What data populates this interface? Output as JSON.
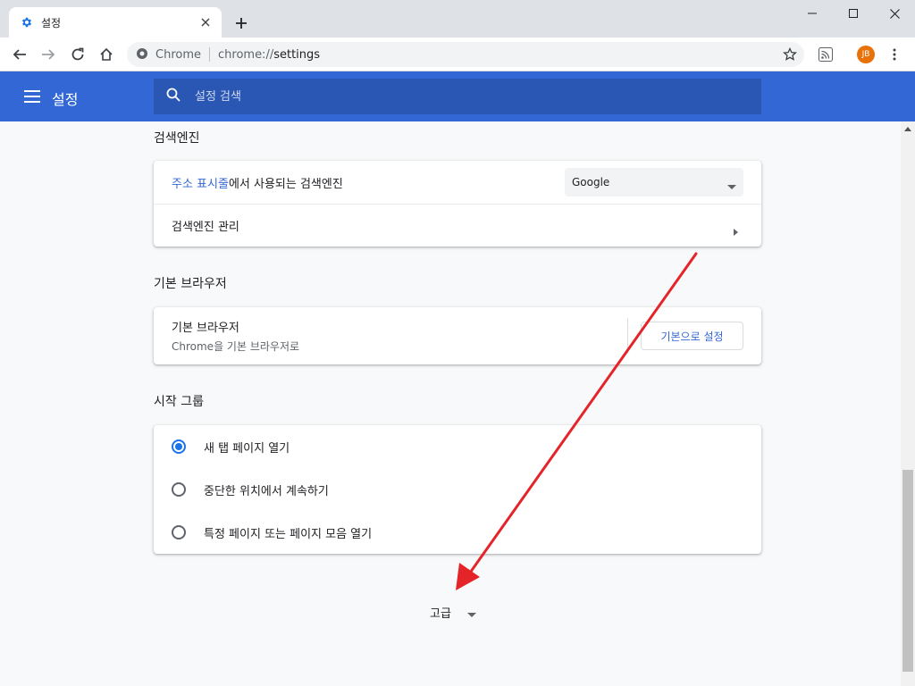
{
  "tab": {
    "title": "설정"
  },
  "omnibox": {
    "site_name": "Chrome",
    "url_scheme": "chrome://",
    "url_path": "settings"
  },
  "profile": {
    "initials": "JB"
  },
  "header": {
    "title": "설정",
    "search_placeholder": "설정 검색"
  },
  "search_engine": {
    "section_title": "검색엔진",
    "row1_link": "주소 표시줄",
    "row1_suffix": "에서 사용되는 검색엔진",
    "selected_engine": "Google",
    "manage_label": "검색엔진 관리"
  },
  "default_browser": {
    "section_title": "기본 브라우저",
    "row_title": "기본 브라우저",
    "row_subtitle": "Chrome을 기본 브라우저로",
    "button_label": "기본으로 설정"
  },
  "startup": {
    "section_title": "시작 그룹",
    "options": [
      {
        "label": "새 탭 페이지 열기",
        "checked": true
      },
      {
        "label": "중단한 위치에서 계속하기",
        "checked": false
      },
      {
        "label": "특정 페이지 또는 페이지 모음 열기",
        "checked": false
      }
    ]
  },
  "advanced": {
    "label": "고급"
  },
  "colors": {
    "header_blue": "#3367d6",
    "accent_blue": "#1a73e8",
    "annotation_red": "#e5242a",
    "avatar_orange": "#e8710a"
  }
}
